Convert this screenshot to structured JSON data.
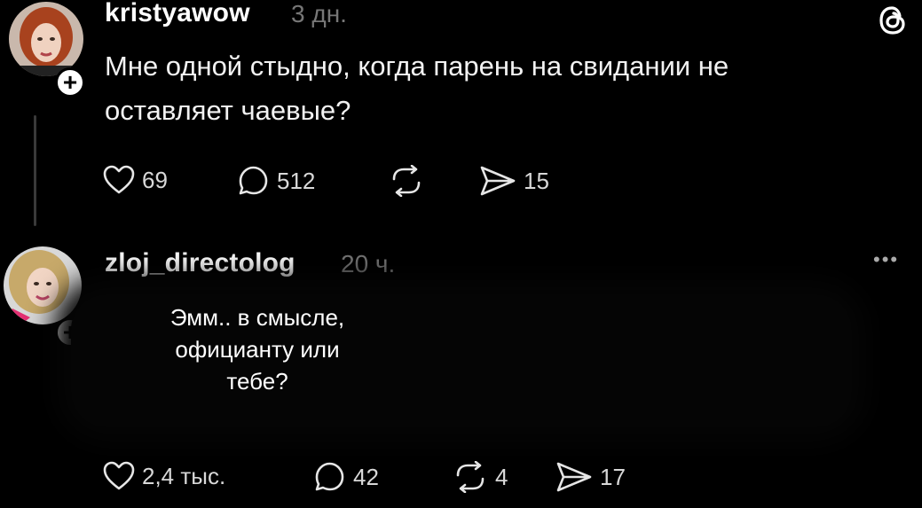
{
  "posts": [
    {
      "username": "kristyawow",
      "time": "3 дн.",
      "text_lines": [
        "Мне одной стыдно, когда парень на свидании не",
        "оставляет чаевые?"
      ],
      "likes": "69",
      "comments": "512",
      "reposts": "",
      "shares": "15"
    },
    {
      "username": "zloj_directolog",
      "time": "20 ч.",
      "text_lines": [
        "Эмм.. в смысле,",
        "официанту или",
        "тебе?"
      ],
      "likes": "2,4 тыс.",
      "comments": "42",
      "reposts": "4",
      "shares": "17"
    }
  ],
  "icons": {
    "app_logo": "threads-logo-icon",
    "like": "heart-icon",
    "comment": "comment-bubble-icon",
    "repost": "repost-icon",
    "share": "send-icon",
    "follow": "plus-icon",
    "more": "more-dots-icon"
  },
  "colors": {
    "background": "#000000",
    "text": "#ffffff",
    "muted": "#777777"
  }
}
